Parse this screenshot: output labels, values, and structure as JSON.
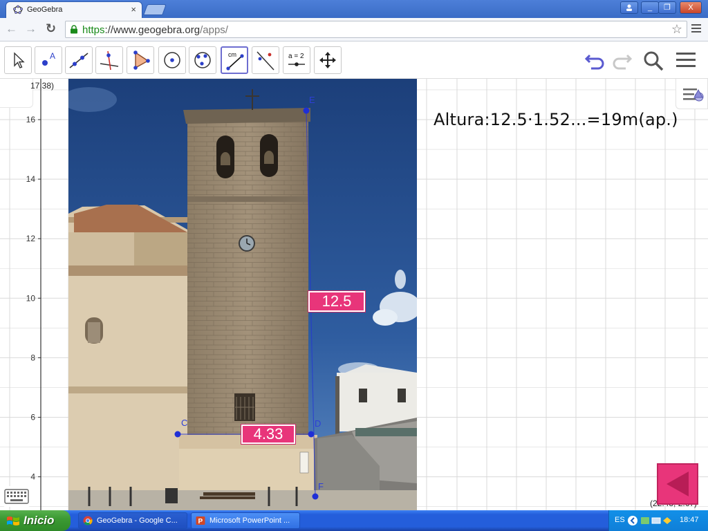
{
  "browser": {
    "tab_title": "GeoGebra",
    "tab_close": "×",
    "url_scheme": "https",
    "url_host": "://www.geogebra.org",
    "url_path": "/apps/",
    "window_buttons": [
      "_",
      "❐",
      "X"
    ]
  },
  "toolbar": {
    "tools": [
      {
        "name": "move-tool",
        "label": ""
      },
      {
        "name": "point-tool",
        "label": "A"
      },
      {
        "name": "line-tool",
        "label": ""
      },
      {
        "name": "perpendicular-line-tool",
        "label": ""
      },
      {
        "name": "polygon-tool",
        "label": ""
      },
      {
        "name": "circle-center-point-tool",
        "label": ""
      },
      {
        "name": "circle-three-points-tool",
        "label": ""
      },
      {
        "name": "distance-tool",
        "label": "cm",
        "selected": true
      },
      {
        "name": "reflect-tool",
        "label": ""
      },
      {
        "name": "slider-tool",
        "label": "a = 2"
      },
      {
        "name": "move-graphics-view-tool",
        "label": ""
      }
    ],
    "undo_icon": "undo-icon",
    "redo_icon": "redo-icon",
    "search_icon": "search-icon",
    "menu_icon": "hamburger-menu-icon"
  },
  "graphics": {
    "annotation": "Altura:12.5·1.52...=19m(ap.)",
    "coord_top": "17.38)",
    "coord_bottom": "(22.43, 2.67)",
    "y_ticks": [
      "16",
      "14",
      "12",
      "10",
      "8",
      "6",
      "4"
    ],
    "measure_height": "12.5",
    "measure_base": "4.33",
    "point_labels": {
      "C": "C",
      "D": "D",
      "E": "E",
      "F": "F"
    },
    "colors": {
      "accent_pink": "#e8357a",
      "point_blue": "#1f2fd6",
      "grid": "#d9d9d9"
    }
  },
  "taskbar": {
    "start_label": "Inicio",
    "tasks": [
      {
        "label": "GeoGebra - Google C...",
        "icon": "chrome-icon"
      },
      {
        "label": "Microsoft PowerPoint ...",
        "icon": "powerpoint-icon"
      }
    ],
    "language": "ES",
    "clock": "18:47"
  }
}
